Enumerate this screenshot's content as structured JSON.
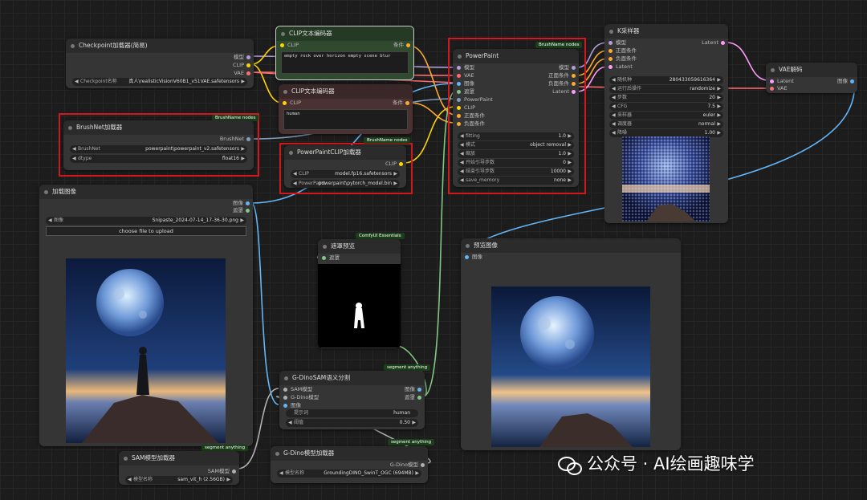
{
  "app": {
    "name": "ComfyUI"
  },
  "colors": {
    "model": "#b39ddb",
    "clip": "#ffd500",
    "vae": "#ff6e6e",
    "conditioning": "#ffa931",
    "latent": "#ff9cf9",
    "image": "#64b5f6",
    "mask": "#81c784",
    "brushnet": "#7fa0c0"
  },
  "checkpoint": {
    "title": "Checkpoint加载器(简易)",
    "out_model": "模型",
    "out_clip": "CLIP",
    "out_vae": "VAE",
    "ckpt_key": "Checkpoint名称",
    "ckpt_val": "真人\\realisticVisionV60B1_v51VAE.safetensors"
  },
  "brushnet_loader": {
    "tag": "BrushName nodes",
    "title": "BrushNet加载器",
    "out": "BrushNet",
    "w1_key": "BrushNet",
    "w1_val": "powerpaint\\powerpaint_v2.safetensors",
    "w2_key": "dtype",
    "w2_val": "float16"
  },
  "clip_pos": {
    "title": "CLIP文本编码器",
    "in_clip": "CLIP",
    "out": "条件",
    "text": "empty rock over horizon empty scene blur"
  },
  "clip_neg": {
    "title": "CLIP文本编码器",
    "in_clip": "CLIP",
    "out": "条件",
    "text": "human"
  },
  "pp_clip": {
    "tag": "BrushName nodes",
    "title": "PowerPaintCLIP加载器",
    "out": "CLIP",
    "w1_key": "CLIP",
    "w1_val": "model.fp16.safetensors",
    "w2_key": "PowerPaint",
    "w2_val": "powerpaint\\pytorch_model.bin"
  },
  "powerpaint": {
    "tag": "BrushName nodes",
    "title": "PowerPaint",
    "inputs": [
      "模型",
      "VAE",
      "图像",
      "遮罩",
      "PowerPaint",
      "CLIP",
      "正面条件",
      "负面条件"
    ],
    "outputs": [
      "模型",
      "正面条件",
      "负面条件",
      "Latent"
    ],
    "widgets": [
      {
        "k": "fitting",
        "v": "1.0"
      },
      {
        "k": "模式",
        "v": "object removal"
      },
      {
        "k": "缩放",
        "v": "1.0"
      },
      {
        "k": "开始引导步数",
        "v": "0"
      },
      {
        "k": "结束引导步数",
        "v": "10000"
      },
      {
        "k": "save_memory",
        "v": "none"
      }
    ]
  },
  "ksampler": {
    "title": "K采样器",
    "inputs": [
      "模型",
      "正面条件",
      "负面条件",
      "Latent"
    ],
    "out": "Latent",
    "widgets": [
      {
        "k": "随机种",
        "v": "280433059616364"
      },
      {
        "k": "运行后操作",
        "v": "randomize"
      },
      {
        "k": "步数",
        "v": "20"
      },
      {
        "k": "CFG",
        "v": "7.5"
      },
      {
        "k": "采样器",
        "v": "euler"
      },
      {
        "k": "调度器",
        "v": "normal"
      },
      {
        "k": "降噪",
        "v": "1.00"
      }
    ]
  },
  "vae_decode": {
    "title": "VAE解码",
    "in_latent": "Latent",
    "in_vae": "VAE",
    "out": "图像"
  },
  "load_image": {
    "title": "加载图像",
    "out_image": "图像",
    "out_mask": "遮罩",
    "w_key": "图像",
    "w_val": "Snipaste_2024-07-14_17-36-30.png",
    "upload": "choose file to upload"
  },
  "mask_preview": {
    "tag": "ComfyUI Essentials",
    "title": "遮罩预览",
    "in": "遮罩"
  },
  "preview": {
    "title": "预览图像",
    "in": "图像"
  },
  "gdino_seg": {
    "tag": "segment anything",
    "title": "G-DinoSAM语义分割",
    "inputs": [
      "SAM模型",
      "G-Dino模型",
      "图像"
    ],
    "outputs": [
      "图像",
      "遮罩"
    ],
    "w1_key": "提示词",
    "w1_val": "human",
    "w2_key": "阈值",
    "w2_val": "0.50"
  },
  "sam_loader": {
    "tag": "segment anything",
    "title": "SAM模型加载器",
    "out": "SAM模型",
    "w_key": "模型名称",
    "w_val": "sam_vit_h (2.56GB)"
  },
  "gdino_loader": {
    "tag": "segment anything",
    "title": "G-Dino模型加载器",
    "out": "G-Dino模型",
    "w_key": "模型名称",
    "w_val": "GroundingDINO_SwinT_OGC (694MB)"
  },
  "watermark": {
    "text": "公众号 · AI绘画趣味学"
  }
}
